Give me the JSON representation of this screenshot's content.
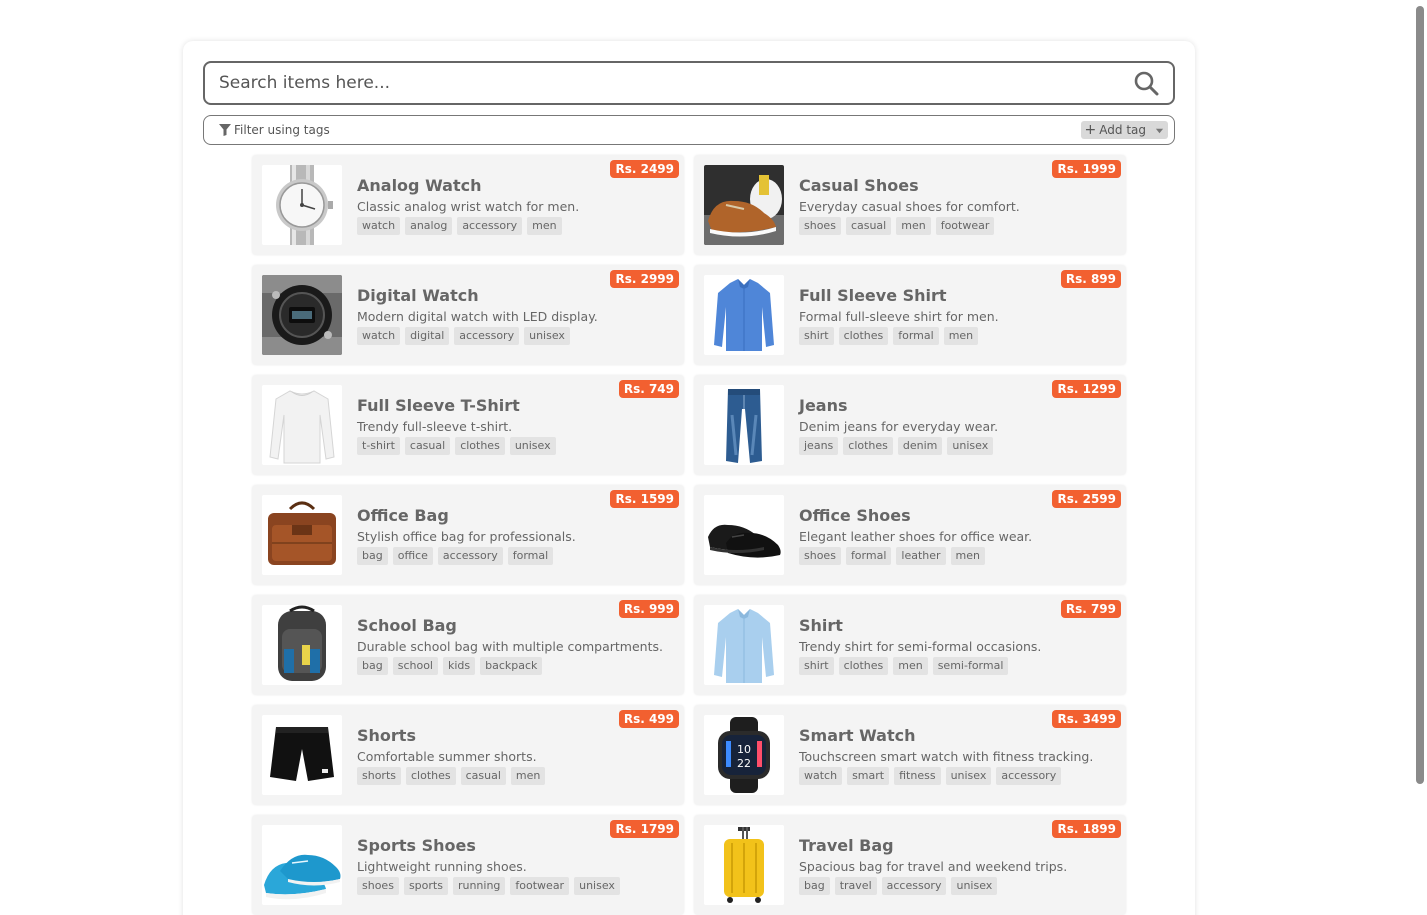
{
  "search": {
    "placeholder": "Search items here..."
  },
  "filter": {
    "label": "Filter using tags",
    "add_tag_label": "Add tag"
  },
  "items": [
    {
      "title": "Analog Watch",
      "description": "Classic analog wrist watch for men.",
      "price": "Rs. 2499",
      "tags": [
        "watch",
        "analog",
        "accessory",
        "men"
      ],
      "image": "analog-watch"
    },
    {
      "title": "Casual Shoes",
      "description": "Everyday casual shoes for comfort.",
      "price": "Rs. 1999",
      "tags": [
        "shoes",
        "casual",
        "men",
        "footwear"
      ],
      "image": "casual-shoes"
    },
    {
      "title": "Digital Watch",
      "description": "Modern digital watch with LED display.",
      "price": "Rs. 2999",
      "tags": [
        "watch",
        "digital",
        "accessory",
        "unisex"
      ],
      "image": "digital-watch"
    },
    {
      "title": "Full Sleeve Shirt",
      "description": "Formal full-sleeve shirt for men.",
      "price": "Rs. 899",
      "tags": [
        "shirt",
        "clothes",
        "formal",
        "men"
      ],
      "image": "blue-shirt"
    },
    {
      "title": "Full Sleeve T-Shirt",
      "description": "Trendy full-sleeve t-shirt.",
      "price": "Rs. 749",
      "tags": [
        "t-shirt",
        "casual",
        "clothes",
        "unisex"
      ],
      "image": "white-tshirt"
    },
    {
      "title": "Jeans",
      "description": "Denim jeans for everyday wear.",
      "price": "Rs. 1299",
      "tags": [
        "jeans",
        "clothes",
        "denim",
        "unisex"
      ],
      "image": "jeans"
    },
    {
      "title": "Office Bag",
      "description": "Stylish office bag for professionals.",
      "price": "Rs. 1599",
      "tags": [
        "bag",
        "office",
        "accessory",
        "formal"
      ],
      "image": "office-bag"
    },
    {
      "title": "Office Shoes",
      "description": "Elegant leather shoes for office wear.",
      "price": "Rs. 2599",
      "tags": [
        "shoes",
        "formal",
        "leather",
        "men"
      ],
      "image": "office-shoes"
    },
    {
      "title": "School Bag",
      "description": "Durable school bag with multiple compartments.",
      "price": "Rs. 999",
      "tags": [
        "bag",
        "school",
        "kids",
        "backpack"
      ],
      "image": "school-bag"
    },
    {
      "title": "Shirt",
      "description": "Trendy shirt for semi-formal occasions.",
      "price": "Rs. 799",
      "tags": [
        "shirt",
        "clothes",
        "men",
        "semi-formal"
      ],
      "image": "light-shirt"
    },
    {
      "title": "Shorts",
      "description": "Comfortable summer shorts.",
      "price": "Rs. 499",
      "tags": [
        "shorts",
        "clothes",
        "casual",
        "men"
      ],
      "image": "shorts"
    },
    {
      "title": "Smart Watch",
      "description": "Touchscreen smart watch with fitness tracking.",
      "price": "Rs. 3499",
      "tags": [
        "watch",
        "smart",
        "fitness",
        "unisex",
        "accessory"
      ],
      "image": "smart-watch"
    },
    {
      "title": "Sports Shoes",
      "description": "Lightweight running shoes.",
      "price": "Rs. 1799",
      "tags": [
        "shoes",
        "sports",
        "running",
        "footwear",
        "unisex"
      ],
      "image": "sports-shoes"
    },
    {
      "title": "Travel Bag",
      "description": "Spacious bag for travel and weekend trips.",
      "price": "Rs. 1899",
      "tags": [
        "bag",
        "travel",
        "accessory",
        "unisex"
      ],
      "image": "travel-bag"
    }
  ],
  "colors": {
    "price_badge": "#f26030",
    "card_bg": "#f4f4f4",
    "tag_bg": "#e3e3e3"
  }
}
